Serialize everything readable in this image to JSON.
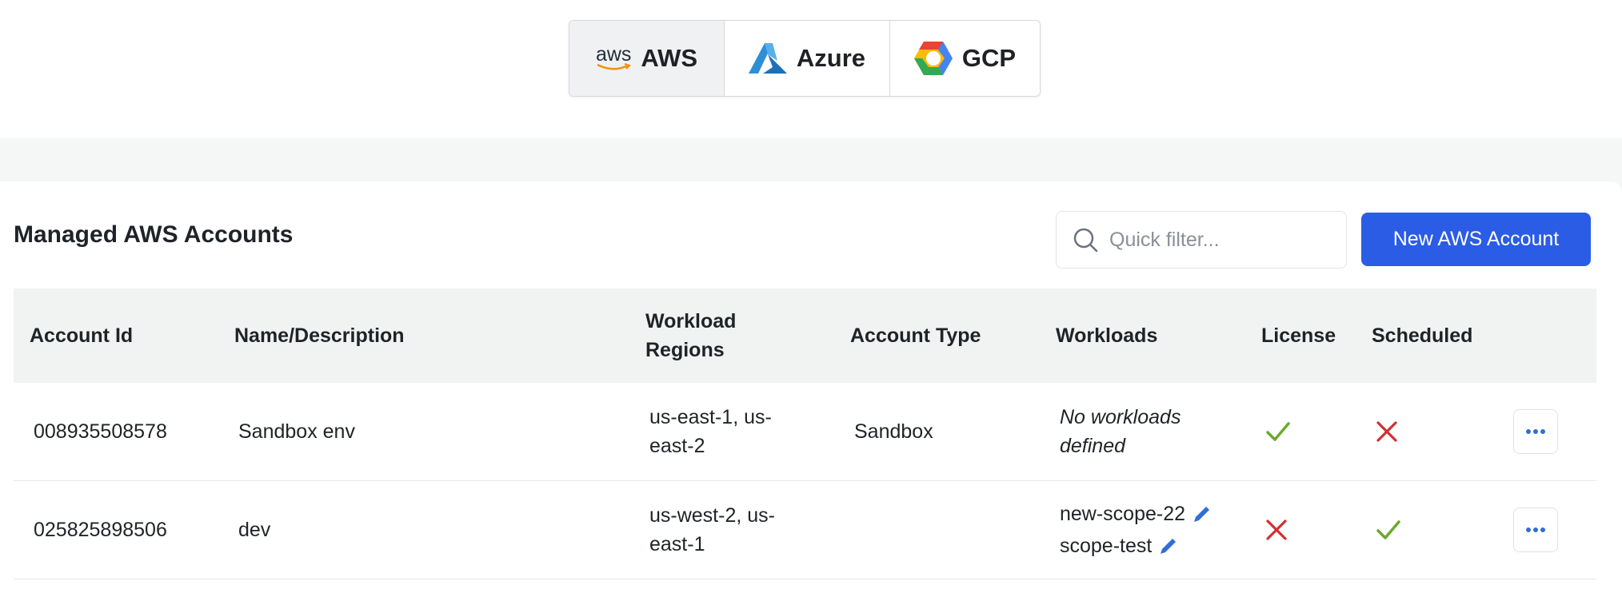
{
  "providers": [
    {
      "label": "AWS",
      "logo_text": "aws",
      "icon": "aws-logo-icon",
      "active": true
    },
    {
      "label": "Azure",
      "icon": "azure-logo-icon",
      "active": false
    },
    {
      "label": "GCP",
      "icon": "gcp-logo-icon",
      "active": false
    }
  ],
  "section": {
    "title": "Managed AWS Accounts"
  },
  "search": {
    "placeholder": "Quick filter...",
    "value": ""
  },
  "new_button": {
    "label": "New AWS Account"
  },
  "table": {
    "headers": {
      "account_id": "Account Id",
      "name": "Name/Description",
      "regions_line1": "Workload",
      "regions_line2": "Regions",
      "account_type": "Account Type",
      "workloads": "Workloads",
      "license": "License",
      "scheduled": "Scheduled"
    },
    "rows": [
      {
        "account_id": "008935508578",
        "name": "Sandbox env",
        "regions_line1": "us-east-1, us-",
        "regions_line2": "east-2",
        "account_type": "Sandbox",
        "workloads_empty_line1": "No workloads",
        "workloads_empty_line2": "defined",
        "license": "check-icon",
        "scheduled": "cross-icon"
      },
      {
        "account_id": "025825898506",
        "name": "dev",
        "regions_line1": "us-west-2, us-",
        "regions_line2": "east-1",
        "account_type": "",
        "workloads": [
          "new-scope-22",
          "scope-test"
        ],
        "license": "cross-icon",
        "scheduled": "check-icon"
      }
    ]
  },
  "colors": {
    "primary": "#2b5ce6",
    "check": "#6aaa2e",
    "cross": "#d32f2f",
    "edit": "#2f6fd6",
    "header_bg": "#f1f2f2",
    "band_bg": "#f5f6f6"
  }
}
